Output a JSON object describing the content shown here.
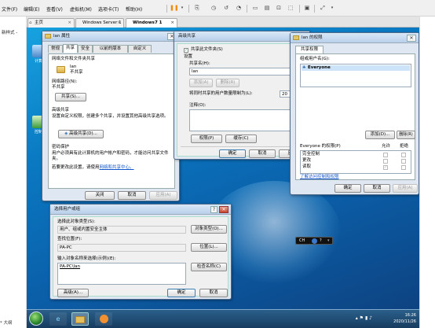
{
  "vm_menu": {
    "items": [
      "文件(F)",
      "编辑(E)",
      "查看(V)",
      "虚拟机(M)",
      "选项卡(T)",
      "帮助(H)"
    ]
  },
  "vm_tabs": [
    {
      "label": "主页"
    },
    {
      "label": "Windows Server 1"
    },
    {
      "label": "Windows7 1"
    }
  ],
  "host_side": {
    "left_text": "新样式 -",
    "bottom_text": "* 大纲"
  },
  "desktop_icons": [
    {
      "label": "计算"
    },
    {
      "label": "控制"
    }
  ],
  "props_dialog": {
    "title": "lan 属性",
    "tabs": [
      "常规",
      "共享",
      "安全",
      "以前的版本",
      "自定义"
    ],
    "section1": "网络文件和文件夹共享",
    "folder_name": "lan",
    "folder_state": "不共享",
    "net_path_label": "网络路径(N):",
    "net_path_value": "不共享",
    "share_button": "共享(S)...",
    "section2": "高级共享",
    "adv_desc": "设置自定义权限，创建多个共享，并设置其他高级共享选项。",
    "adv_button": "高级共享(D)...",
    "section3": "密码保护",
    "pwd_desc": "用户必须具有此计算机的用户帐户和密码，才能访问共享文件夹。",
    "pwd_link_prefix": "若要更改此设置，请使用",
    "pwd_link": "网络和共享中心。",
    "close_button": "关闭",
    "cancel_button": "取消",
    "apply_button": "应用(A)"
  },
  "adv_dialog": {
    "title": "高级共享",
    "share_checkbox": "共享此文件夹(S)",
    "settings_label": "设置",
    "share_name_label": "共享名(H):",
    "share_name_value": "lan",
    "add_button": "添加(A)",
    "delete_button": "删除(R)",
    "limit_label": "将同时共享的用户数量限制为(L):",
    "limit_value": "20",
    "comment_label": "注释(O):",
    "perm_button": "权限(P)",
    "cache_button": "缓存(C)",
    "ok_button": "确定",
    "cancel_button": "取消",
    "apply_button": "应用"
  },
  "perm_dialog": {
    "title": "lan 的权限",
    "tab": "共享权限",
    "group_label": "组或用户名(G):",
    "users": [
      "Everyone"
    ],
    "add_button": "添加(D)...",
    "delete_button": "删除(R)",
    "perm_for_label": "Everyone 的权限(P)",
    "allow_header": "允许",
    "deny_header": "拒绝",
    "permissions": [
      {
        "name": "完全控制",
        "allow": false,
        "deny": false
      },
      {
        "name": "更改",
        "allow": false,
        "deny": false
      },
      {
        "name": "读取",
        "allow": true,
        "deny": false
      }
    ],
    "learn_link": "了解访问控制和权限",
    "ok_button": "确定",
    "cancel_button": "取消",
    "apply_button": "应用(A)"
  },
  "select_dialog": {
    "title": "选择用户或组",
    "obj_type_label": "选择此对象类型(S):",
    "obj_type_value": "用户、组或内置安全主体",
    "obj_type_button": "对象类型(O)...",
    "location_label": "查找位置(F):",
    "location_value": "PA-PC",
    "location_button": "位置(L)...",
    "enter_label": "输入对象名称来选择(示例)(E):",
    "enter_value": "PA-PC\\lan",
    "check_button": "检查名称(C)",
    "advanced_button": "高级(A)...",
    "ok_button": "确定",
    "cancel_button": "取消"
  },
  "overlay": {
    "lang": "CH"
  },
  "taskbar": {
    "time": "16:26",
    "date": "2020/11/26"
  }
}
